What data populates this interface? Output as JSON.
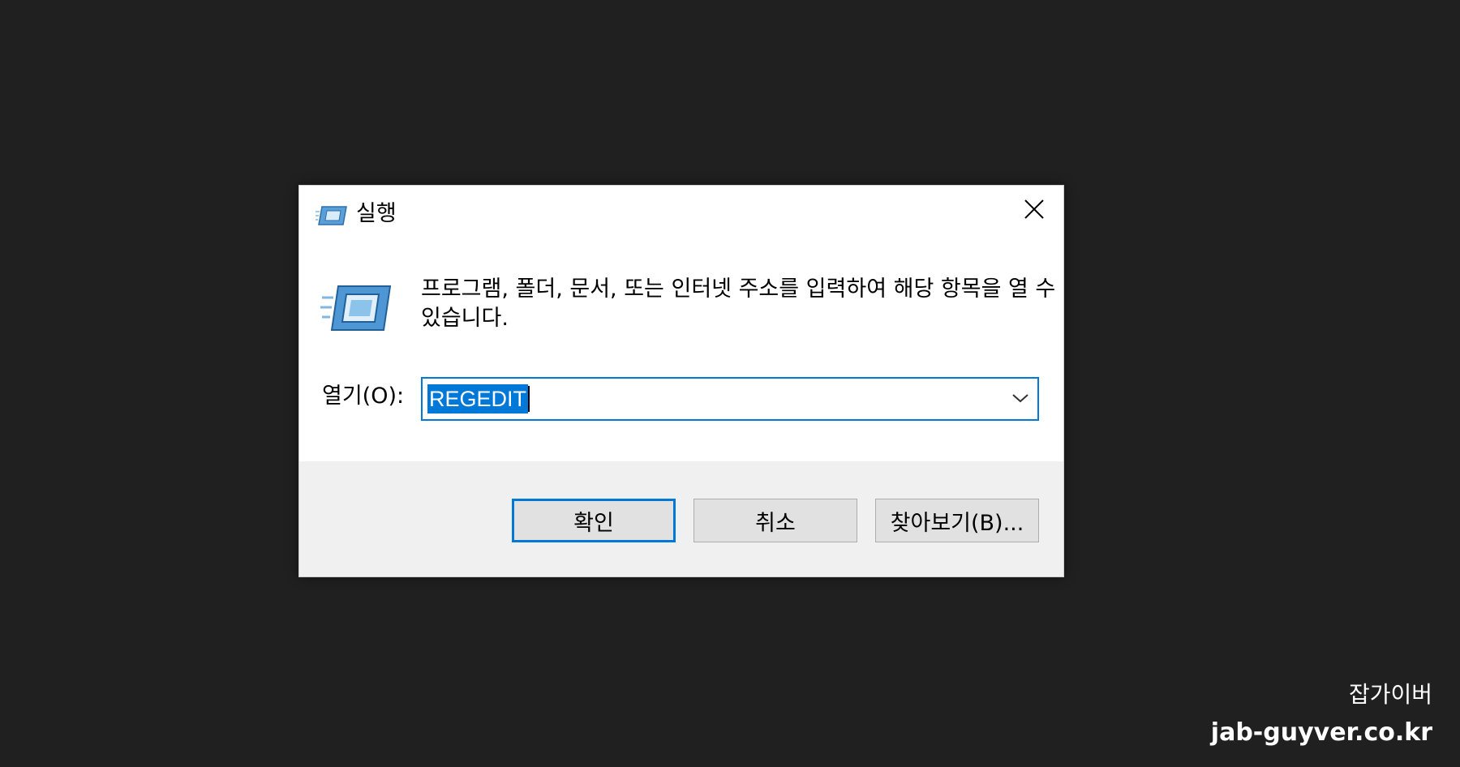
{
  "dialog": {
    "title": "실행",
    "icon": "run-icon",
    "close_icon": "close-icon",
    "description": "프로그램, 폴더, 문서, 또는 인터넷 주소를 입력하여 해당 항목을 열 수 있습니다.",
    "open_label": "열기(O):",
    "input_value": "REGEDIT",
    "dropdown_icon": "chevron-down-icon",
    "buttons": {
      "ok": "확인",
      "cancel": "취소",
      "browse": "찾아보기(B)..."
    }
  },
  "watermark": {
    "name": "잡가이버",
    "url": "jab-guyver.co.kr"
  },
  "colors": {
    "background": "#202020",
    "accent": "#0078d7",
    "footer": "#f0f0f0",
    "button": "#e1e1e1"
  }
}
